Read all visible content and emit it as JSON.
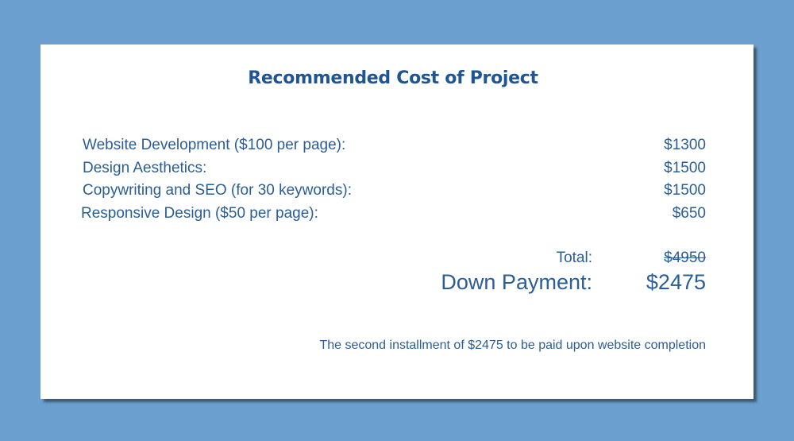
{
  "title": "Recommended Cost of Project",
  "items": [
    {
      "label": "Website Development ($100 per page):",
      "value": "$1300"
    },
    {
      "label": "Design Aesthetics:",
      "value": "$1500"
    },
    {
      "label": "Copywriting and SEO (for 30 keywords):",
      "value": "$1500"
    },
    {
      "label": "Responsive Design ($50 per page):",
      "value": "$650"
    }
  ],
  "total": {
    "label": "Total:",
    "value": "$4950"
  },
  "down_payment": {
    "label": "Down Payment:",
    "value": "$2475"
  },
  "footnote": "The second installment of $2475 to be paid upon website completion",
  "colors": {
    "background": "#6a9fcf",
    "card": "#ffffff",
    "title": "#1e5592",
    "text": "#2a5e97"
  }
}
